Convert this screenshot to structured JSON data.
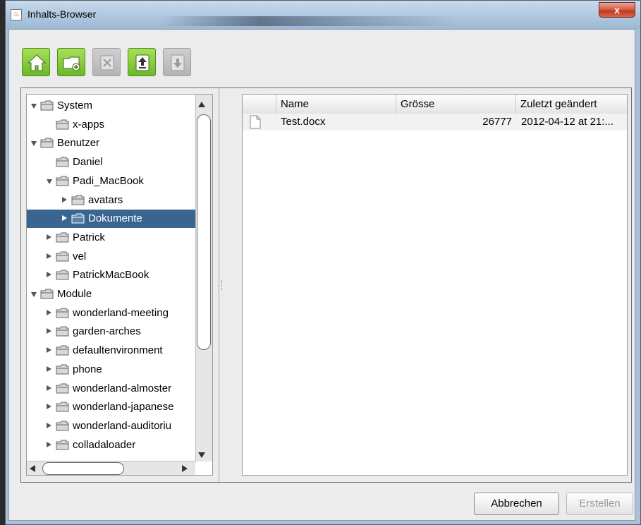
{
  "window": {
    "title": "Inhalts-Browser",
    "app_icon": "java-icon",
    "close_label": "x"
  },
  "toolbar": [
    {
      "name": "home-button",
      "icon": "home-icon",
      "enabled": true
    },
    {
      "name": "new-folder-button",
      "icon": "new-folder-icon",
      "enabled": true
    },
    {
      "name": "delete-button",
      "icon": "delete-icon",
      "enabled": false
    },
    {
      "name": "upload-button",
      "icon": "upload-icon",
      "enabled": true
    },
    {
      "name": "download-button",
      "icon": "download-icon",
      "enabled": false
    }
  ],
  "tree": {
    "items": [
      {
        "label": "System",
        "level": 0,
        "expander": "expanded"
      },
      {
        "label": "x-apps",
        "level": 1,
        "expander": "none"
      },
      {
        "label": "Benutzer",
        "level": 0,
        "expander": "expanded"
      },
      {
        "label": "Daniel",
        "level": 1,
        "expander": "none"
      },
      {
        "label": "Padi_MacBook",
        "level": 1,
        "expander": "expanded"
      },
      {
        "label": "avatars",
        "level": 2,
        "expander": "collapsed"
      },
      {
        "label": "Dokumente",
        "level": 2,
        "expander": "collapsed",
        "selected": true
      },
      {
        "label": "Patrick",
        "level": 1,
        "expander": "collapsed"
      },
      {
        "label": "vel",
        "level": 1,
        "expander": "collapsed"
      },
      {
        "label": "PatrickMacBook",
        "level": 1,
        "expander": "collapsed"
      },
      {
        "label": "Module",
        "level": 0,
        "expander": "expanded"
      },
      {
        "label": "wonderland-meeting",
        "level": 1,
        "expander": "collapsed"
      },
      {
        "label": "garden-arches",
        "level": 1,
        "expander": "collapsed"
      },
      {
        "label": "defaultenvironment",
        "level": 1,
        "expander": "collapsed"
      },
      {
        "label": "phone",
        "level": 1,
        "expander": "collapsed"
      },
      {
        "label": "wonderland-almoster",
        "level": 1,
        "expander": "collapsed"
      },
      {
        "label": "wonderland-japanese",
        "level": 1,
        "expander": "collapsed"
      },
      {
        "label": "wonderland-auditoriu",
        "level": 1,
        "expander": "collapsed"
      },
      {
        "label": "colladaloader",
        "level": 1,
        "expander": "collapsed"
      }
    ]
  },
  "table": {
    "columns": [
      "Name",
      "Grösse",
      "Zuletzt geändert"
    ],
    "rows": [
      {
        "icon": "document-icon",
        "name": "Test.docx",
        "size": "26777",
        "modified": "2012-04-12 at 21:..."
      }
    ]
  },
  "buttons": {
    "cancel_label": "Abbrechen",
    "create_label": "Erstellen"
  },
  "colors": {
    "selection": "#3a6591",
    "toolbar_enabled": "#7ac232",
    "close_button": "#c9432a"
  }
}
